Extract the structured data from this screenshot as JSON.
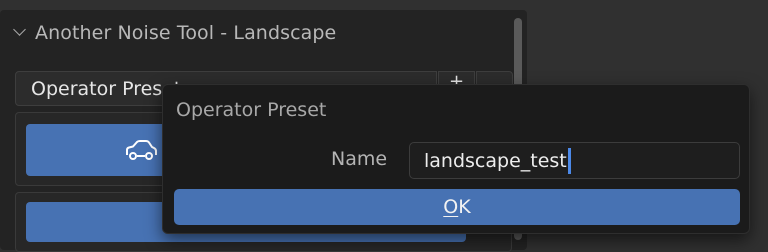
{
  "panel": {
    "title": "Another Noise Tool - Landscape",
    "preset_dropdown": {
      "label": "Operator Preset",
      "add_label": "+",
      "remove_label": ""
    },
    "buttons": [
      {
        "icon": "car-icon",
        "label": ""
      },
      {
        "icon": "",
        "label": ""
      }
    ]
  },
  "dialog": {
    "title": "Operator Preset",
    "name_label": "Name",
    "name_value": "landscape_test",
    "ok": {
      "underlined_letter": "O",
      "rest": "K"
    }
  },
  "colors": {
    "accent": "#4772b3",
    "caret": "#4c89e8",
    "dialog_bg": "#1b1b1b",
    "panel_bg": "#232323"
  }
}
